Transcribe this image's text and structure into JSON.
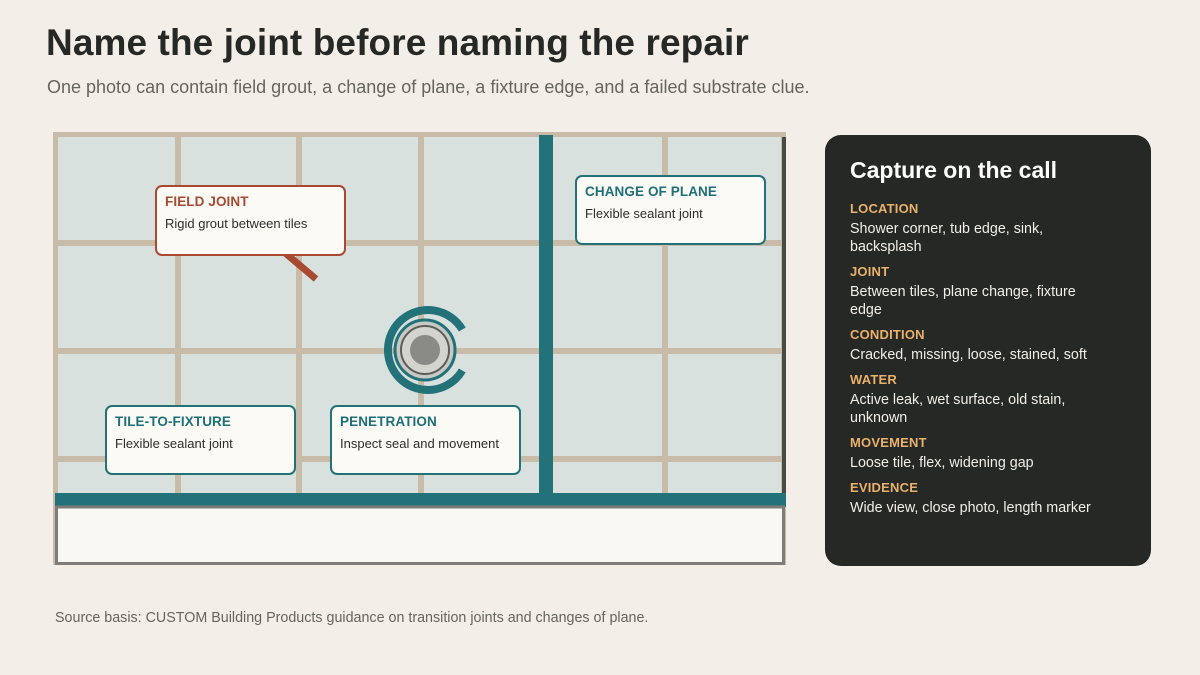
{
  "header": {
    "title": "Name the joint before naming the repair",
    "subtitle": "One photo can contain field grout, a change of plane, a fixture edge, and a failed substrate clue."
  },
  "diagram": {
    "callouts": [
      {
        "id": "field",
        "title": "FIELD JOINT",
        "desc": "Rigid grout between tiles",
        "color": "#a74a31"
      },
      {
        "id": "plane",
        "title": "CHANGE OF PLANE",
        "desc": "Flexible sealant joint",
        "color": "#23727a"
      },
      {
        "id": "fixture",
        "title": "TILE-TO-FIXTURE",
        "desc": "Flexible sealant joint",
        "color": "#23727a"
      },
      {
        "id": "penetration",
        "title": "PENETRATION",
        "desc": "Inspect seal and movement",
        "color": "#23727a"
      }
    ],
    "colors": {
      "tile": "#d9e1de",
      "grout": "#c8bca9",
      "sealant": "#23727a",
      "tub": "#faf8f2",
      "fixture": "#8f8f8a"
    }
  },
  "panel": {
    "title": "Capture on the call",
    "items": [
      {
        "label": "LOCATION",
        "value": "Shower corner, tub edge, sink, backsplash"
      },
      {
        "label": "JOINT",
        "value": "Between tiles, plane change, fixture edge"
      },
      {
        "label": "CONDITION",
        "value": "Cracked, missing, loose, stained, soft"
      },
      {
        "label": "WATER",
        "value": "Active leak, wet surface, old stain, unknown"
      },
      {
        "label": "MOVEMENT",
        "value": "Loose tile, flex, widening gap"
      },
      {
        "label": "EVIDENCE",
        "value": "Wide view, close photo, length marker"
      }
    ]
  },
  "footer": {
    "source": "Source basis: CUSTOM Building Products guidance on transition joints and changes of plane."
  }
}
